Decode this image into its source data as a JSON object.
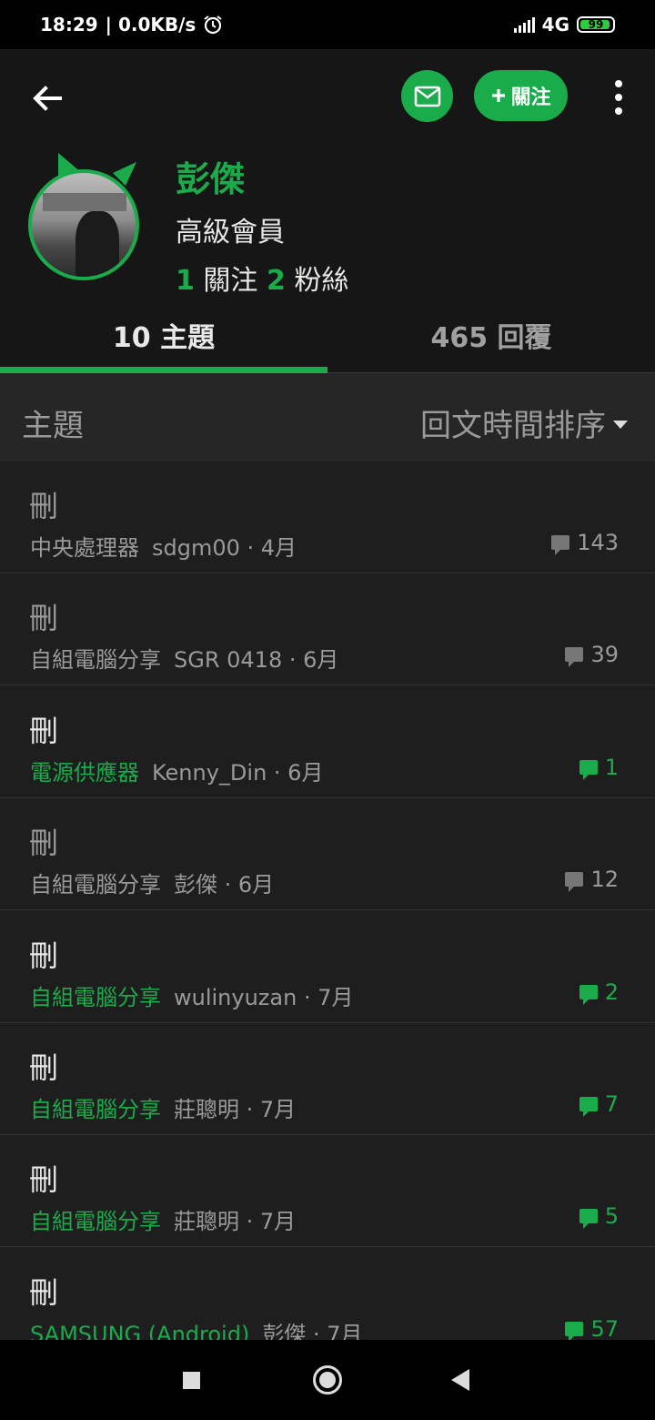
{
  "status_bar": {
    "time": "18:29",
    "speed": "| 0.0KB/s",
    "network": "4G",
    "battery": "99"
  },
  "header": {
    "follow_label": "關注"
  },
  "profile": {
    "name": "彭傑",
    "rank": "高級會員",
    "following_count": "1",
    "following_label": "關注",
    "followers_count": "2",
    "followers_label": "粉絲"
  },
  "tabs": [
    {
      "label": "10 主題"
    },
    {
      "label": "465 回覆"
    }
  ],
  "sort_bar": {
    "label": "主題",
    "sort_label": "回文時間排序"
  },
  "colors": {
    "accent": "#1aab4b",
    "background": "#1e1e1e",
    "muted_text": "#9a9a9a"
  },
  "topics": [
    {
      "title": "刪",
      "category": "中央處理器",
      "author_time": "sdgm00 · 4月",
      "replies": "143",
      "highlight": false
    },
    {
      "title": "刪",
      "category": "自組電腦分享",
      "author_time": "SGR 0418 · 6月",
      "replies": "39",
      "highlight": false
    },
    {
      "title": "刪",
      "category": "電源供應器",
      "author_time": "Kenny_Din · 6月",
      "replies": "1",
      "highlight": true
    },
    {
      "title": "刪",
      "category": "自組電腦分享",
      "author_time": "彭傑 · 6月",
      "replies": "12",
      "highlight": false
    },
    {
      "title": "刪",
      "category": "自組電腦分享",
      "author_time": "wulinyuzan · 7月",
      "replies": "2",
      "highlight": true
    },
    {
      "title": "刪",
      "category": "自組電腦分享",
      "author_time": "莊聰明 · 7月",
      "replies": "7",
      "highlight": true
    },
    {
      "title": "刪",
      "category": "自組電腦分享",
      "author_time": "莊聰明 · 7月",
      "replies": "5",
      "highlight": true
    },
    {
      "title": "刪",
      "category": "SAMSUNG (Android)",
      "author_time": "彭傑 · 7月",
      "replies": "57",
      "highlight": true
    }
  ]
}
